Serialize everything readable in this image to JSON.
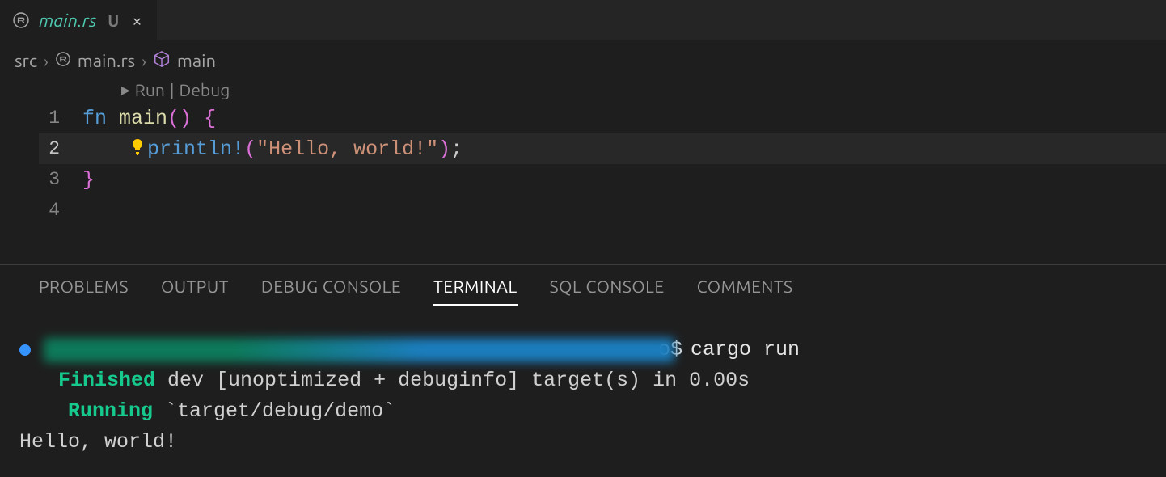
{
  "tab": {
    "filename": "main.rs",
    "status": "U",
    "close": "×"
  },
  "breadcrumb": {
    "folder": "src",
    "file": "main.rs",
    "symbol": "main"
  },
  "codelens": {
    "run": "Run",
    "sep": "|",
    "debug": "Debug"
  },
  "code": {
    "line1": {
      "num": "1",
      "kw": "fn ",
      "name": "main",
      "p1": "(",
      "p2": ")",
      "sp": " ",
      "brace": "{"
    },
    "line2": {
      "num": "2",
      "indent": "    ",
      "macro": "println",
      "bang": "!",
      "p1": "(",
      "str": "\"Hello, world!\"",
      "p2": ")",
      "semi": ";"
    },
    "line3": {
      "num": "3",
      "brace": "}"
    },
    "line4": {
      "num": "4"
    }
  },
  "panel": {
    "tabs": {
      "problems": "PROBLEMS",
      "output": "OUTPUT",
      "debug_console": "DEBUG CONSOLE",
      "terminal": "TERMINAL",
      "sql_console": "SQL CONSOLE",
      "comments": "COMMENTS"
    }
  },
  "terminal": {
    "prompt_suffix": "o$ ",
    "command": "cargo run",
    "finished_label": "Finished",
    "finished_text": " dev [unoptimized + debuginfo] target(s) in 0.00s",
    "running_label": "Running",
    "running_text": " `target/debug/demo`",
    "output": "Hello, world!"
  }
}
